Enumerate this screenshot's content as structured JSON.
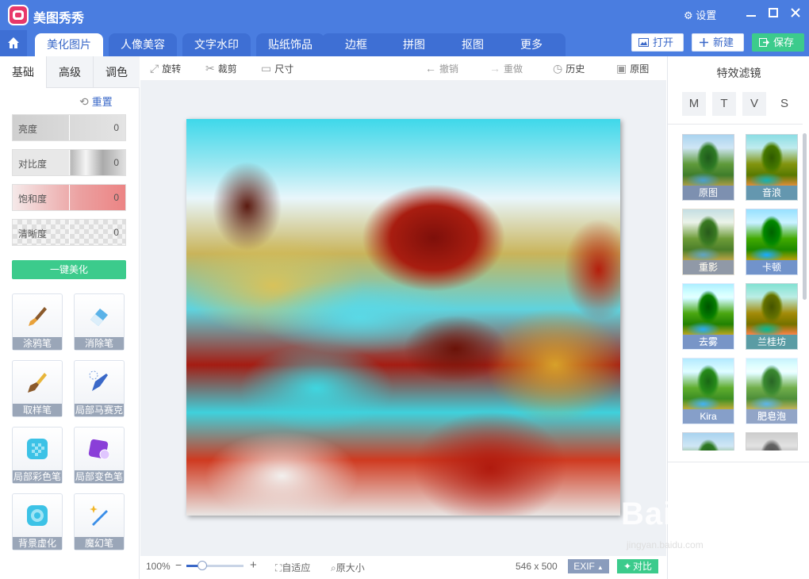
{
  "app": {
    "name": "美图秀秀",
    "settings": "设置"
  },
  "tabs": [
    "美化图片",
    "人像美容",
    "文字水印",
    "贴纸饰品",
    "边框",
    "拼图",
    "抠图",
    "更多"
  ],
  "top_buttons": {
    "open": "打开",
    "new": "新建",
    "save": "保存"
  },
  "left": {
    "tabs": [
      "基础",
      "高级",
      "调色"
    ],
    "reset": "重置",
    "sliders": [
      {
        "label": "亮度",
        "value": "0"
      },
      {
        "label": "对比度",
        "value": "0"
      },
      {
        "label": "饱和度",
        "value": "0"
      },
      {
        "label": "清晰度",
        "value": "0"
      }
    ],
    "onekey": "一键美化",
    "tools": [
      "涂鸦笔",
      "消除笔",
      "取样笔",
      "局部马赛克",
      "局部彩色笔",
      "局部变色笔",
      "背景虚化",
      "魔幻笔"
    ]
  },
  "toolbar": {
    "rotate": "旋转",
    "crop": "裁剪",
    "size": "尺寸",
    "undo": "撤销",
    "redo": "重做",
    "history": "历史",
    "original": "原图"
  },
  "bottom": {
    "zoom": "100%",
    "fit": "自适应",
    "actual": "原大小",
    "dimensions": "546 x 500",
    "exif": "EXIF",
    "compare": "对比",
    "zoom_level": 0.28
  },
  "right": {
    "title": "特效滤镜",
    "letters": [
      "M",
      "T",
      "V",
      "S"
    ],
    "filters": [
      "原图",
      "音浪",
      "重影",
      "卡顿",
      "去雾",
      "兰桂坊",
      "Kira",
      "肥皂泡"
    ]
  },
  "watermark": {
    "text": "Baidu经验",
    "url": "jingyan.baidu.com"
  },
  "colors": {
    "brand": "#4a7de0",
    "accent": "#3ccb8c",
    "link": "#3a68c8"
  }
}
